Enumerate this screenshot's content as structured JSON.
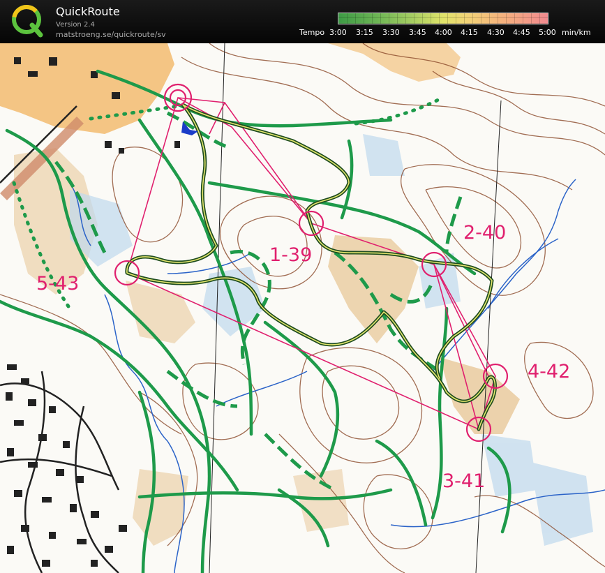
{
  "app": {
    "title": "QuickRoute",
    "version": "Version 2.4",
    "url": "matstroeng.se/quickroute/sv",
    "logo_letter": "Q",
    "logo_icon": "quickroute-q-logo-icon"
  },
  "tempo_legend": {
    "prefix": "Tempo",
    "ticks": [
      "3:00",
      "3:15",
      "3:30",
      "3:45",
      "4:00",
      "4:15",
      "4:30",
      "4:45",
      "5:00"
    ],
    "unit": "min/km",
    "colors": [
      "#3d9a45",
      "#a5cd62",
      "#e0e36a",
      "#f4b27d",
      "#f28a8f"
    ]
  },
  "map": {
    "controls": [
      {
        "id": "start",
        "label": ""
      },
      {
        "id": "1",
        "label": "1-39"
      },
      {
        "id": "2",
        "label": "2-40"
      },
      {
        "id": "3",
        "label": "3-41"
      },
      {
        "id": "4",
        "label": "4-42"
      },
      {
        "id": "5",
        "label": "5-43"
      }
    ],
    "course_color": "#e0206e",
    "route_color": "#1f6b2a",
    "track_color": "#1e9a4a"
  }
}
